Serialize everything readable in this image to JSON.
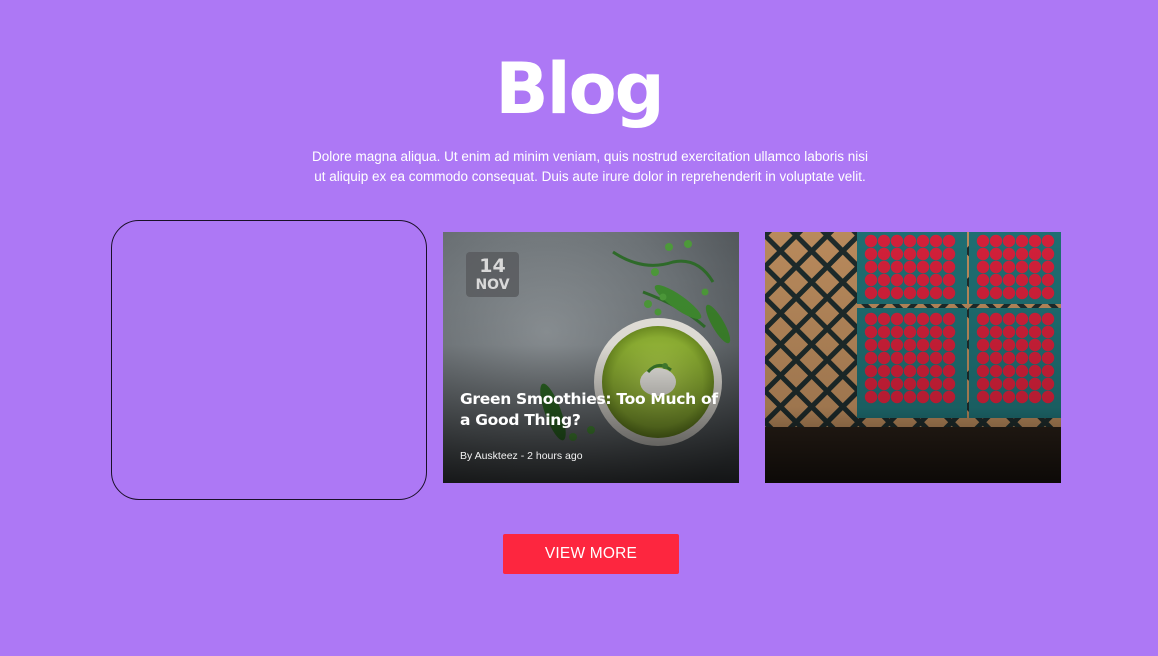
{
  "section": {
    "title": "Blog",
    "intro": "Dolore magna aliqua. Ut enim ad minim veniam, quis nostrud exercitation ullamco laboris nisi ut aliquip ex ea commodo consequat. Duis aute irure dolor in reprehenderit in voluptate velit."
  },
  "posts": [
    {
      "date_day": "14",
      "date_month": "NOV",
      "title": "Green Smoothies: Too Much of a Good Thing?",
      "meta": "By Auskteez - 2 hours ago",
      "image": "green-soup-photo"
    },
    {
      "image": "raspberries-photo"
    }
  ],
  "view_more_label": "VIEW MORE",
  "colors": {
    "background": "#ad78f5",
    "button": "#fd263f",
    "text": "#ffffff"
  }
}
